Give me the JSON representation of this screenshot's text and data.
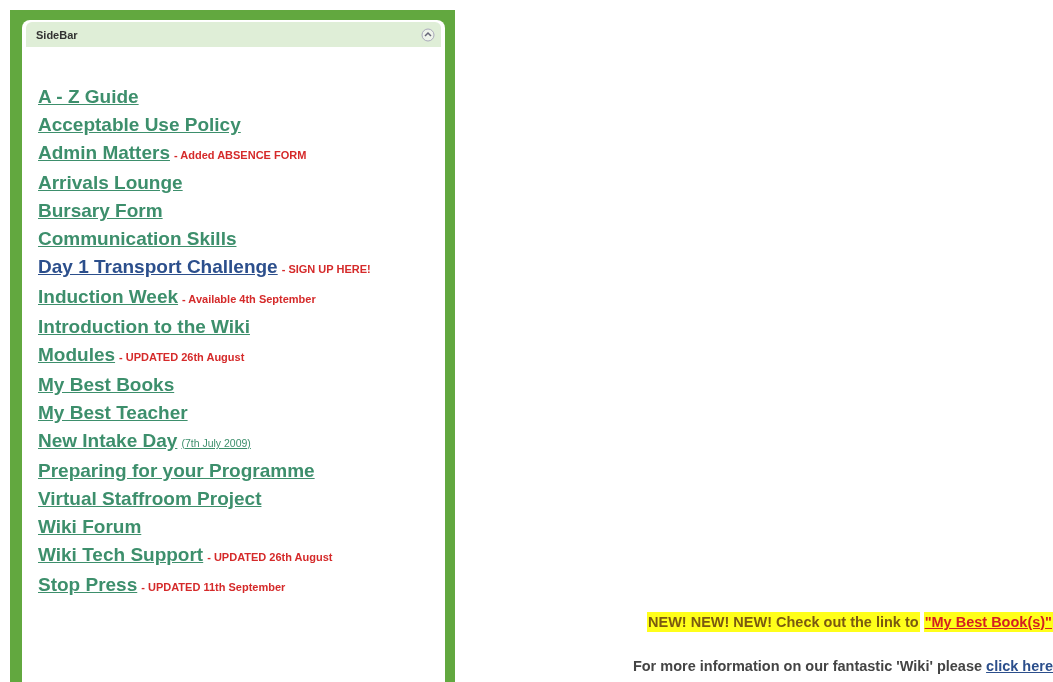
{
  "sidebar": {
    "title": "SideBar",
    "collapsed": false,
    "links": [
      {
        "label": "A - Z Guide",
        "visited": false
      },
      {
        "label": "Acceptable Use Policy",
        "visited": false
      },
      {
        "label": "Admin Matters",
        "visited": false,
        "note": {
          "kind": "alert",
          "text": "- Added ABSENCE FORM"
        }
      },
      {
        "label": "Arrivals Lounge",
        "visited": false
      },
      {
        "label": "Bursary Form",
        "visited": false
      },
      {
        "label": "Communication Skills",
        "visited": false
      },
      {
        "label": "Day 1 Transport Challenge",
        "visited": true,
        "note": {
          "kind": "alert",
          "text": "- SIGN UP HERE!"
        }
      },
      {
        "label": "Induction Week",
        "visited": false,
        "note": {
          "kind": "alert",
          "text": "- Available 4th September"
        }
      },
      {
        "label": "Introduction to the Wiki",
        "visited": false
      },
      {
        "label": "Modules",
        "visited": false,
        "note": {
          "kind": "alert",
          "text": "- UPDATED 26th August"
        }
      },
      {
        "label": "My Best Books",
        "visited": false
      },
      {
        "label": "My Best Teacher",
        "visited": false
      },
      {
        "label": "New Intake Day",
        "visited": false,
        "note": {
          "kind": "link",
          "text": "(7th July 2009)"
        }
      },
      {
        "label": "Preparing for your Programme",
        "visited": false
      },
      {
        "label": "Virtual Staffroom Project",
        "visited": false
      },
      {
        "label": "Wiki Forum",
        "visited": false
      },
      {
        "label": "Wiki Tech Support",
        "visited": false,
        "note": {
          "kind": "alert",
          "text": "- UPDATED 26th August"
        }
      },
      {
        "label": "Stop Press",
        "visited": false,
        "note": {
          "kind": "alert",
          "text": "- UPDATED 11th September"
        }
      }
    ]
  },
  "notice": {
    "text": "NEW! NEW! NEW! Check out the link to",
    "link": "\"My Best Book(s)\""
  },
  "info": {
    "text": "For more information on our fantastic 'Wiki' please",
    "link": "click here"
  }
}
